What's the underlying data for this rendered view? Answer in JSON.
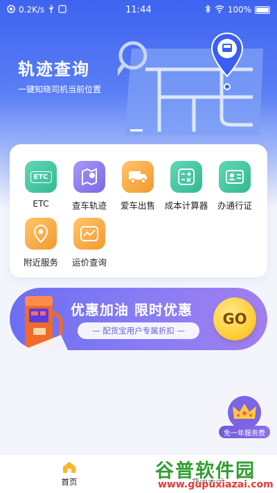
{
  "status_bar": {
    "network_speed": "0.2K/s",
    "time": "11:44",
    "battery": "100%"
  },
  "hero": {
    "title": "轨迹查询",
    "subtitle": "一键知晓司机当前位置"
  },
  "tools": [
    {
      "label": "ETC",
      "icon": "etc-icon",
      "icon_text": "ETC",
      "color": "#46c9a6"
    },
    {
      "label": "查车轨迹",
      "icon": "map-pin-icon",
      "color": "#8b78ef"
    },
    {
      "label": "爱车出售",
      "icon": "truck-icon",
      "color": "#f7a640"
    },
    {
      "label": "成本计算器",
      "icon": "calculator-icon",
      "color": "#46c9a6"
    },
    {
      "label": "办通行证",
      "icon": "id-card-icon",
      "color": "#46c9a6"
    },
    {
      "label": "附近服务",
      "icon": "location-icon",
      "color": "#f7a640"
    },
    {
      "label": "运价查询",
      "icon": "price-trend-icon",
      "color": "#f7a640"
    }
  ],
  "banner": {
    "title": "优惠加油  限时优惠",
    "subtitle": "—  配货宝用户专属折扣  —",
    "go_label": "GO"
  },
  "vip": {
    "label": "免一年服务费"
  },
  "tabbar": {
    "home_label": "首页",
    "cargo_label": "货源大厅"
  },
  "watermark": {
    "title": "谷普软件园",
    "url": "www.gupuxiazai.com"
  },
  "colors": {
    "accent": "#3e63f0",
    "banner": "#8a7df4",
    "go": "#ffcf3a"
  }
}
